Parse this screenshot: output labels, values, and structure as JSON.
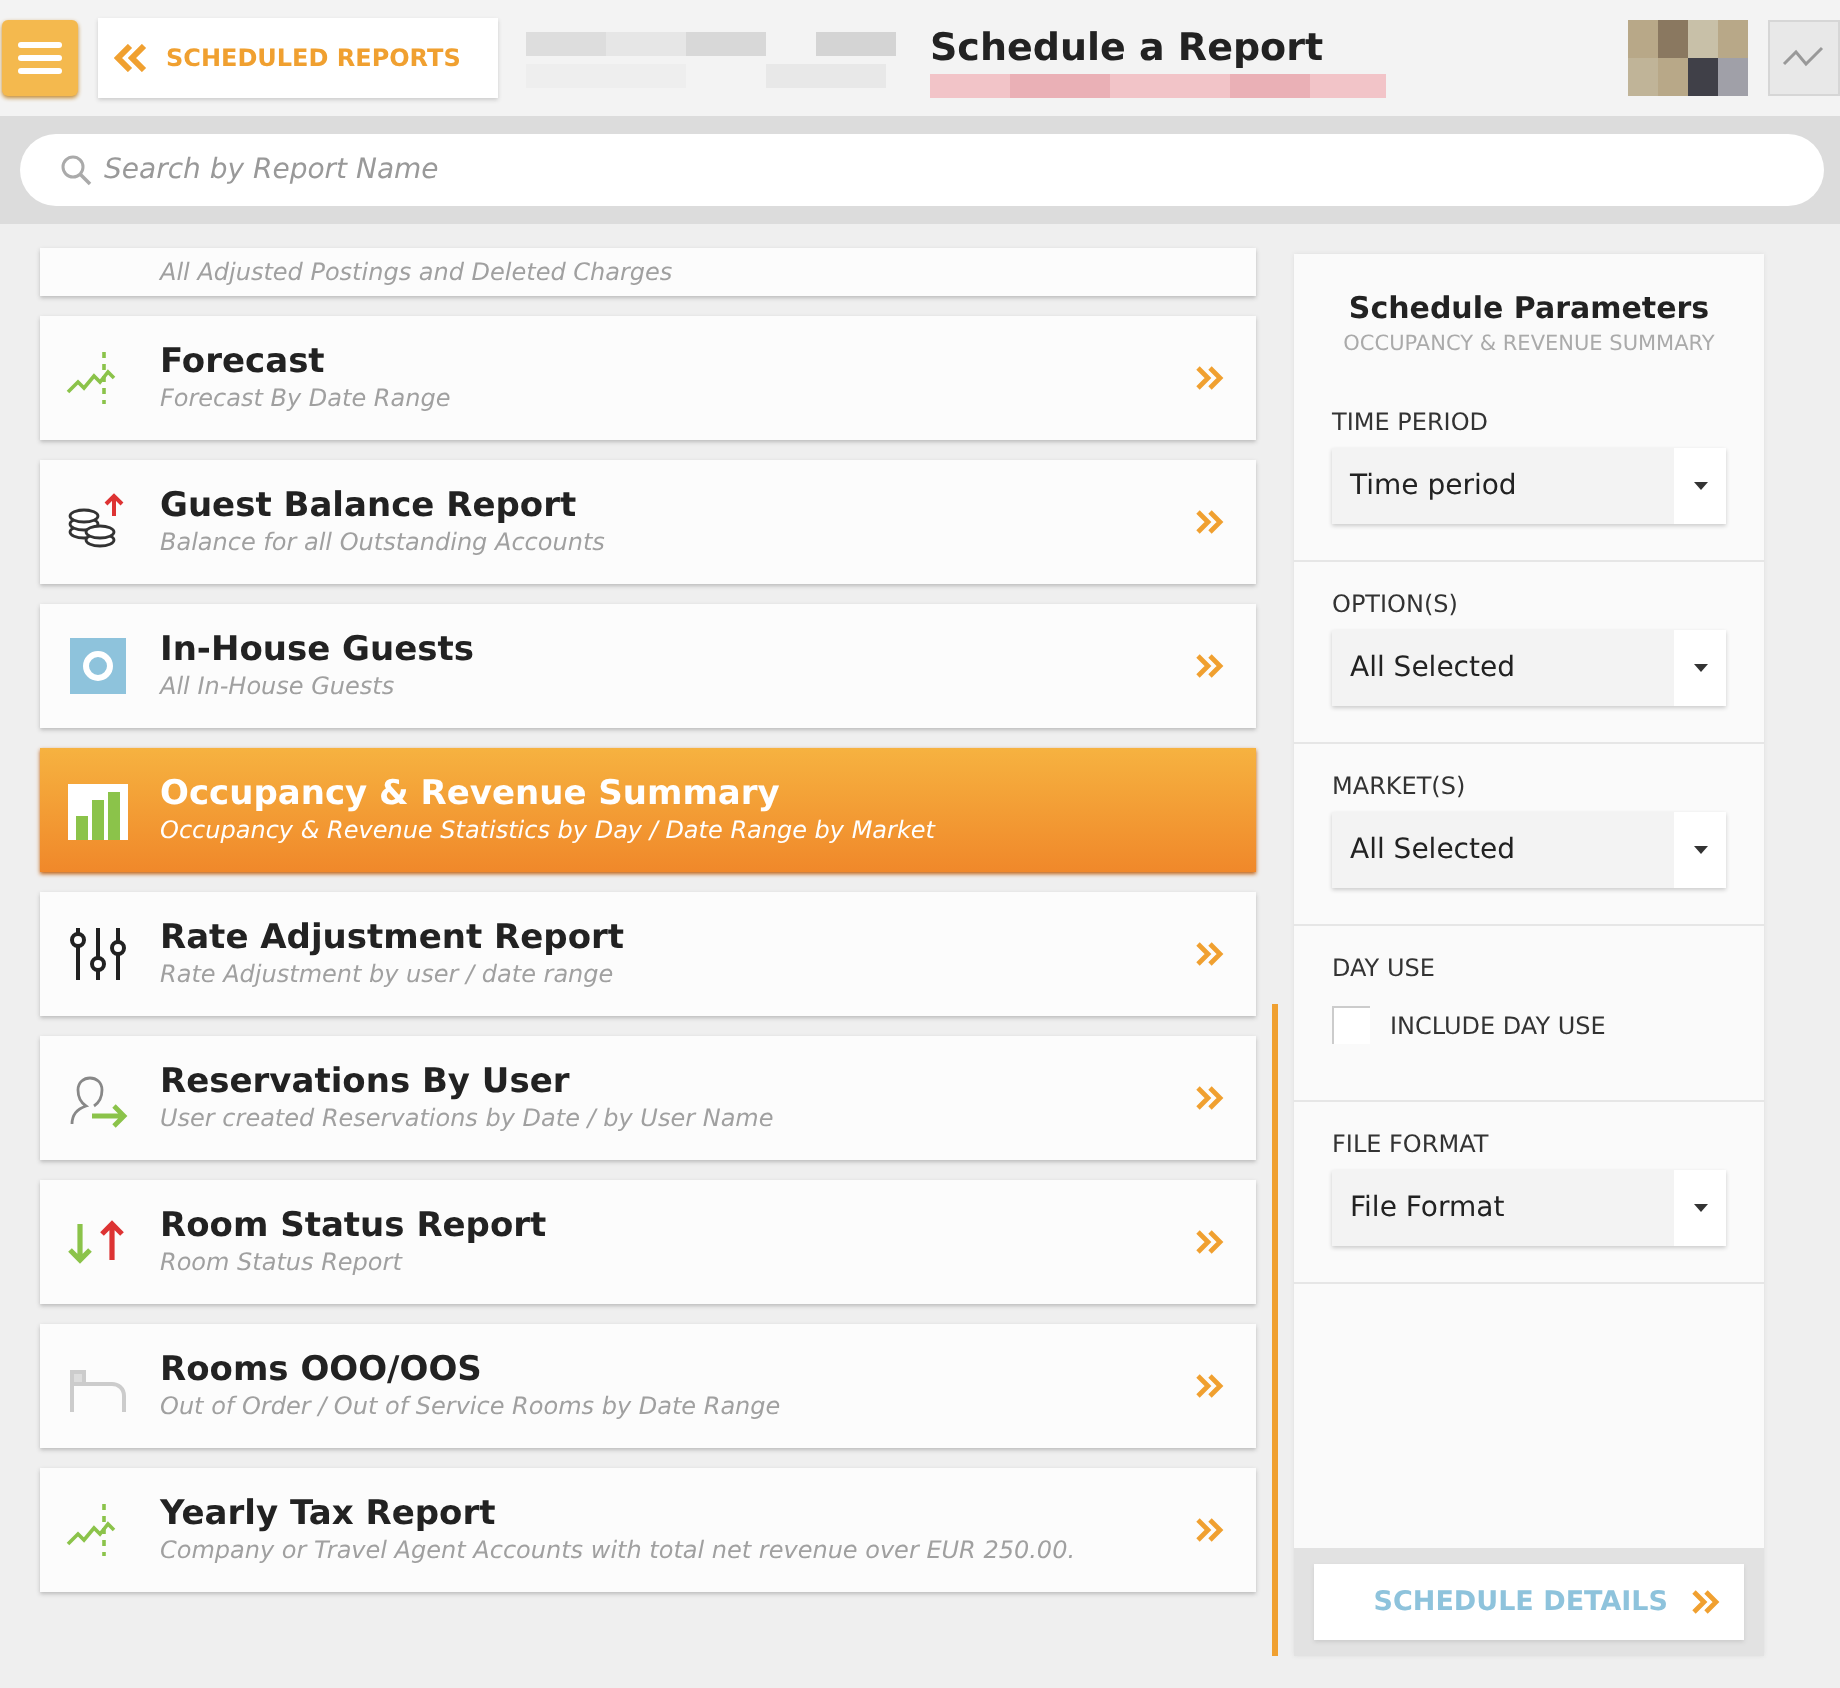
{
  "header": {
    "back_link": "SCHEDULED REPORTS",
    "title": "Schedule a Report"
  },
  "search": {
    "placeholder": "Search by Report Name"
  },
  "reports": [
    {
      "subtitle": "All Adjusted Postings and Deleted Charges",
      "partial": true,
      "selected": false
    },
    {
      "kind": "trend",
      "title": "Forecast",
      "subtitle": "Forecast By Date Range",
      "selected": false
    },
    {
      "kind": "coins",
      "title": "Guest Balance Report",
      "subtitle": "Balance for all Outstanding Accounts",
      "selected": false
    },
    {
      "kind": "guests",
      "title": "In-House Guests",
      "subtitle": "All In-House Guests",
      "selected": false
    },
    {
      "kind": "bars",
      "title": "Occupancy & Revenue Summary",
      "subtitle": "Occupancy & Revenue Statistics by Day / Date Range by Market",
      "selected": true
    },
    {
      "kind": "sliders",
      "title": "Rate Adjustment Report",
      "subtitle": "Rate Adjustment by user / date range",
      "selected": false
    },
    {
      "kind": "user",
      "title": "Reservations By User",
      "subtitle": "User created Reservations by Date / by User Name",
      "selected": false
    },
    {
      "kind": "updown",
      "title": "Room Status Report",
      "subtitle": "Room Status Report",
      "selected": false
    },
    {
      "kind": "bed",
      "title": "Rooms OOO/OOS",
      "subtitle": "Out of Order / Out of Service Rooms by Date Range",
      "selected": false
    },
    {
      "kind": "trend",
      "title": "Yearly Tax Report",
      "subtitle": "Company or Travel Agent Accounts with total net revenue over EUR 250.00.",
      "selected": false
    }
  ],
  "parameters": {
    "title": "Schedule Parameters",
    "subtitle": "OCCUPANCY & REVENUE SUMMARY",
    "sections": [
      {
        "kind": "select",
        "label": "TIME PERIOD",
        "value": "Time period"
      },
      {
        "kind": "select",
        "label": "OPTION(S)",
        "value": "All Selected"
      },
      {
        "kind": "select",
        "label": "MARKET(S)",
        "value": "All Selected"
      },
      {
        "kind": "checkbox",
        "label": "DAY USE",
        "option": "INCLUDE DAY USE",
        "checked": false
      },
      {
        "kind": "select",
        "label": "FILE FORMAT",
        "value": "File Format"
      }
    ],
    "button": "SCHEDULE DETAILS"
  }
}
